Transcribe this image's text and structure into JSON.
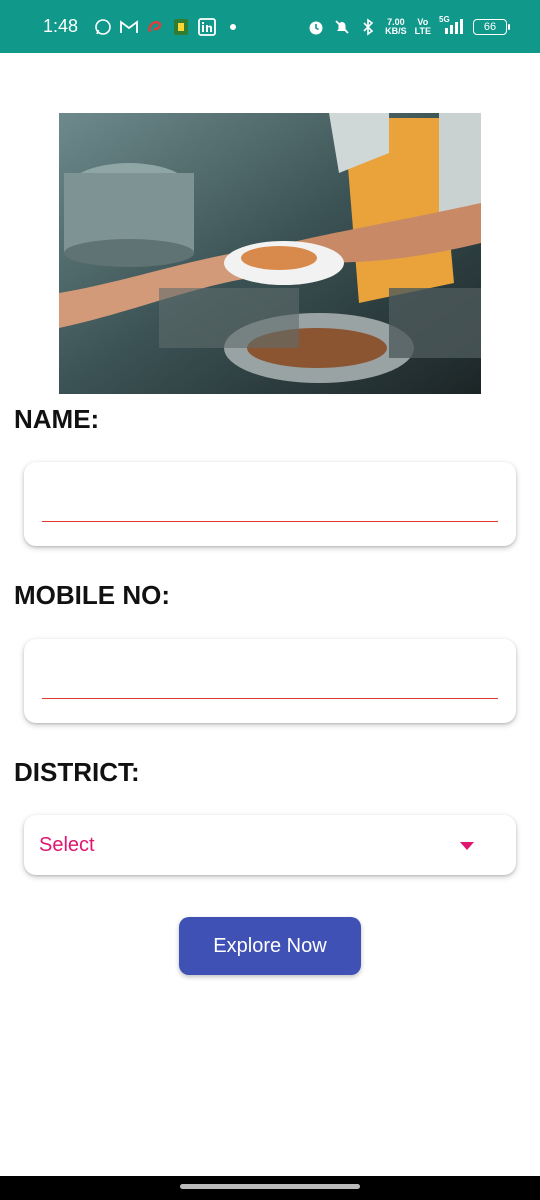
{
  "status_bar": {
    "time": "1:48",
    "left_icons": [
      "whatsapp-icon",
      "gmail-icon",
      "airtel-icon",
      "app-icon",
      "linkedin-icon"
    ],
    "net_speed_value": "7.00",
    "net_speed_unit": "KB/S",
    "volte_top": "Vo",
    "volte_bottom": "LTE",
    "signal_label": "5G",
    "battery": "66"
  },
  "form": {
    "name_label": "NAME:",
    "name_value": "",
    "mobile_label": "MOBILE NO:",
    "mobile_value": "",
    "district_label": "DISTRICT:",
    "district_selected": "Select"
  },
  "actions": {
    "explore_label": "Explore Now"
  },
  "colors": {
    "status_bar": "#10988a",
    "select_text": "#e0156f",
    "input_underline": "#e0392c",
    "button": "#3f51b5"
  }
}
